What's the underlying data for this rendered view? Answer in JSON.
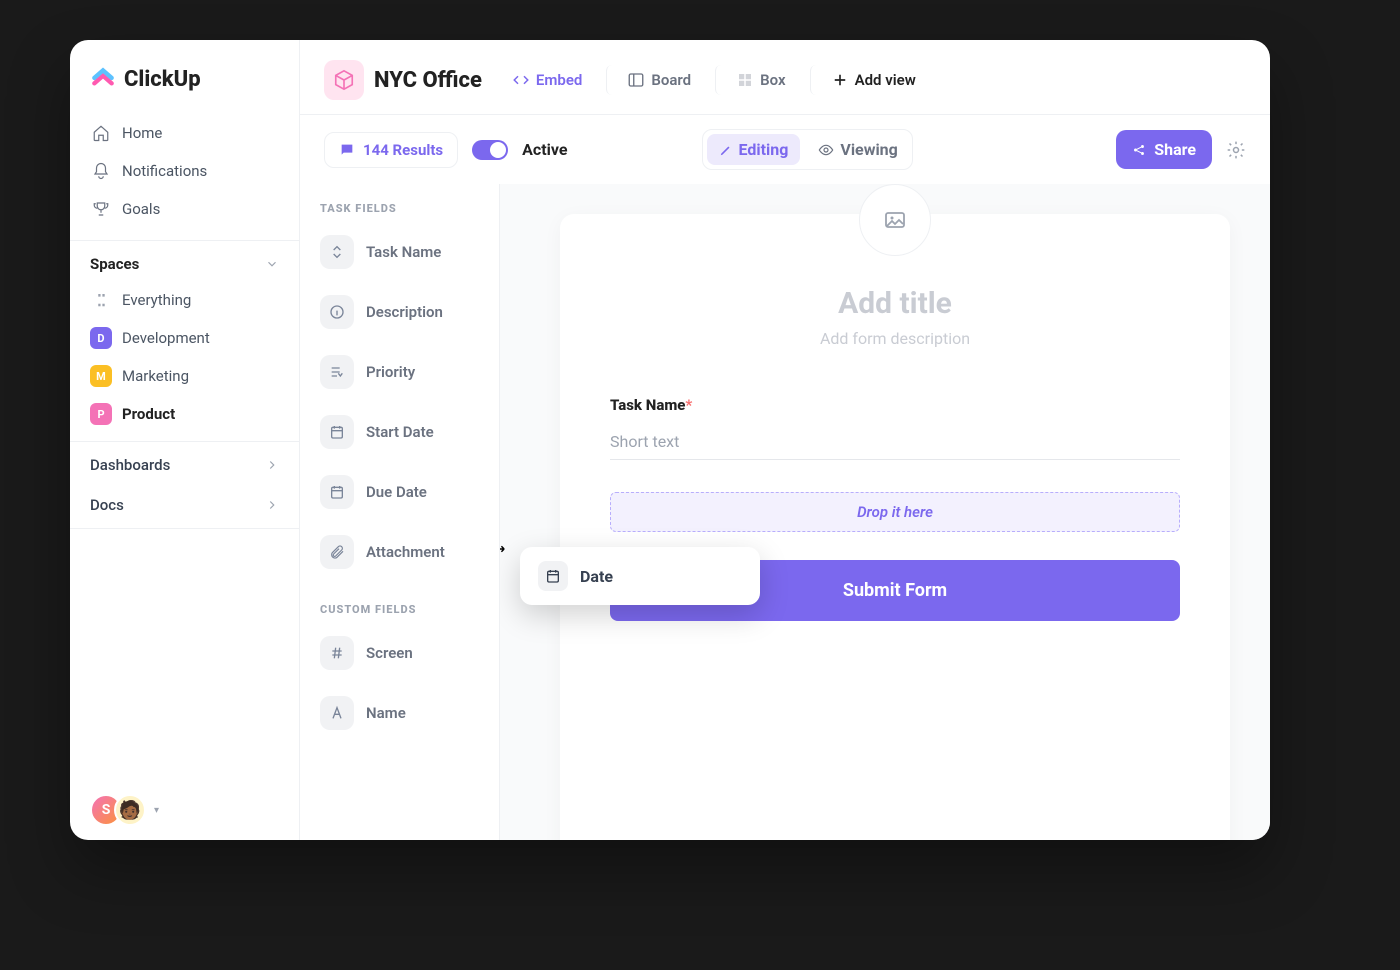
{
  "brand": "ClickUp",
  "sidebar": {
    "nav": [
      {
        "label": "Home",
        "icon": "home-icon"
      },
      {
        "label": "Notifications",
        "icon": "bell-icon"
      },
      {
        "label": "Goals",
        "icon": "trophy-icon"
      }
    ],
    "spaces_header": "Spaces",
    "spaces": [
      {
        "label": "Everything",
        "badge": "",
        "style": "dots"
      },
      {
        "label": "Development",
        "badge": "D",
        "style": "vio"
      },
      {
        "label": "Marketing",
        "badge": "M",
        "style": "yel"
      },
      {
        "label": "Product",
        "badge": "P",
        "style": "pnk",
        "bold": true
      }
    ],
    "dashboards": "Dashboards",
    "docs": "Docs",
    "user_initial": "S"
  },
  "header": {
    "space_name": "NYC Office",
    "tabs": [
      {
        "label": "Embed",
        "icon": "code-icon",
        "active": true
      },
      {
        "label": "Board",
        "icon": "board-icon"
      },
      {
        "label": "Box",
        "icon": "box-icon"
      },
      {
        "label": "Add view",
        "icon": "plus-icon",
        "add": true
      }
    ]
  },
  "subheader": {
    "results": "144 Results",
    "active": "Active",
    "editing": "Editing",
    "viewing": "Viewing",
    "share": "Share"
  },
  "fields": {
    "task_title": "TASK FIELDS",
    "task": [
      {
        "label": "Task Name",
        "icon": "name-icon"
      },
      {
        "label": "Description",
        "icon": "info-icon"
      },
      {
        "label": "Priority",
        "icon": "priority-icon"
      },
      {
        "label": "Start Date",
        "icon": "calendar-icon"
      },
      {
        "label": "Due Date",
        "icon": "calendar-icon"
      },
      {
        "label": "Attachment",
        "icon": "attach-icon"
      }
    ],
    "custom_title": "CUSTOM FIELDS",
    "custom": [
      {
        "label": "Screen",
        "icon": "hash-icon"
      },
      {
        "label": "Name",
        "icon": "letter-icon"
      }
    ]
  },
  "form": {
    "title_placeholder": "Add title",
    "desc_placeholder": "Add form description",
    "field1_label": "Task Name",
    "field1_hint": "Short text",
    "drop_hint": "Drop it here",
    "submit": "Submit Form"
  },
  "drag": {
    "label": "Date"
  }
}
